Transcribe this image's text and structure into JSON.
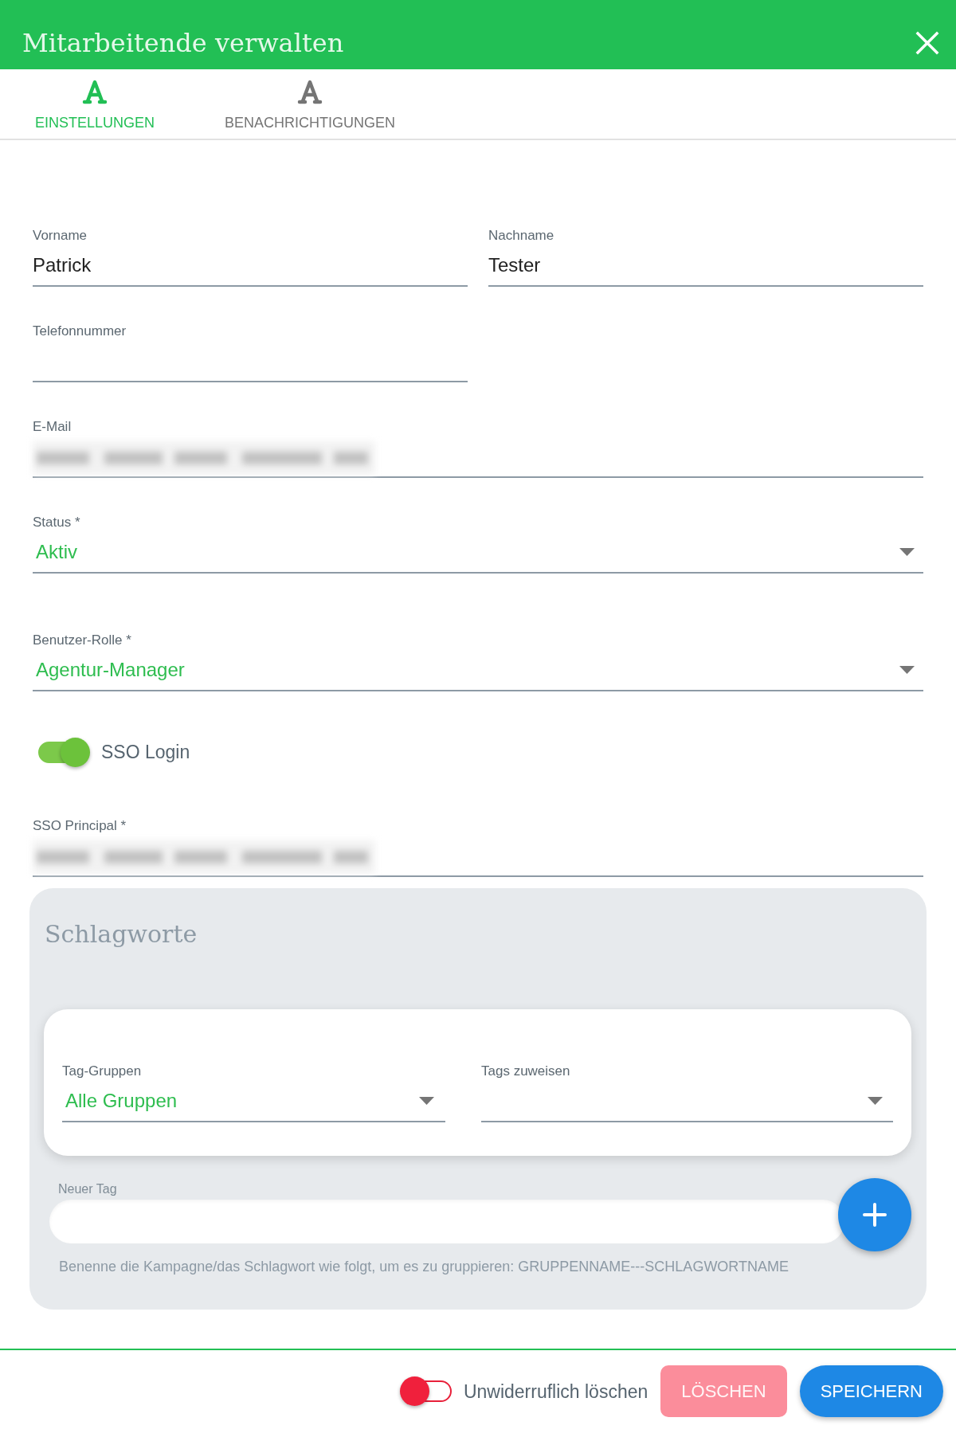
{
  "window": {
    "title": "Mitarbeitende verwalten"
  },
  "tabs": [
    {
      "label": "EINSTELLUNGEN",
      "selected": true
    },
    {
      "label": "BENACHRICHTIGUNGEN",
      "selected": false
    }
  ],
  "name_fields": [
    {
      "label": "Vorname",
      "value": "Patrick"
    },
    {
      "label": "Nachname",
      "value": "Tester"
    }
  ],
  "phone_field": {
    "label": "Telefonnummer"
  },
  "email_field": {
    "label": "E-Mail",
    "redacted": true
  },
  "status_select": {
    "label": "Status *",
    "value": "Aktiv"
  },
  "role_select": {
    "label": "Benutzer-Rolle *",
    "value": "Agentur-Manager"
  },
  "sso_toggle": {
    "label": "SSO Login",
    "on": true
  },
  "sso_principal_field": {
    "label": "SSO Principal *",
    "redacted": true
  },
  "tags_panel": {
    "title": "Schlagworte",
    "selects": [
      {
        "label": "Tag-Gruppen",
        "value": "Alle Gruppen"
      },
      {
        "label": "Tags zuweisen"
      }
    ],
    "new_tag_field": {
      "label": "Neuer Tag"
    },
    "hint": "Benenne die Kampagne/das Schlagwort wie folgt, um es zu gruppieren: GRUPPENNAME---SCHLAGWORTNAME"
  },
  "footer": {
    "delete_toggle": {
      "label": "Unwiderruflich löschen",
      "on": false
    },
    "buttons": [
      {
        "kind": "delete",
        "label": "LÖSCHEN",
        "disabled": true
      },
      {
        "kind": "save",
        "label": "SPEICHERN",
        "disabled": false
      }
    ]
  }
}
